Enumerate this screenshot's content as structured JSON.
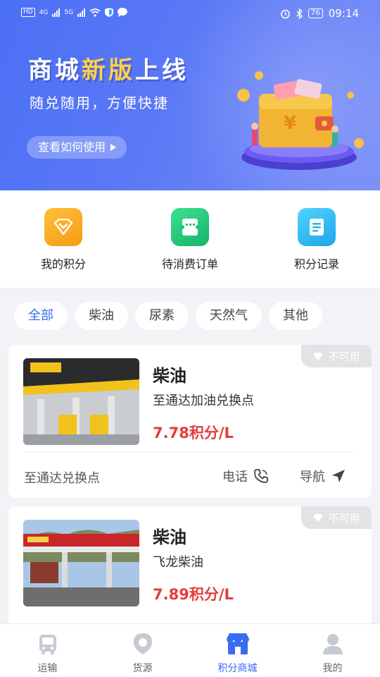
{
  "status_bar": {
    "left_chips": [
      "HD",
      "4G",
      "5G"
    ],
    "battery": "76",
    "time": "09:14"
  },
  "banner": {
    "title_part1": "商城",
    "title_part2": "新版",
    "title_part3": "上线",
    "subtitle": "随兑随用，方便快捷",
    "button_label": "查看如何使用",
    "wallet_symbol": "¥"
  },
  "quick_actions": [
    {
      "label": "我的积分",
      "icon": "diamond-icon",
      "color": "#f7a21b"
    },
    {
      "label": "待消费订单",
      "icon": "ticket-icon",
      "color": "#1fc478"
    },
    {
      "label": "积分记录",
      "icon": "document-icon",
      "color": "#28b9f0"
    }
  ],
  "filters": {
    "items": [
      "全部",
      "柴油",
      "尿素",
      "天然气",
      "其他"
    ],
    "active": "全部"
  },
  "listings": [
    {
      "tag": "不可用",
      "title": "柴油",
      "name": "至通达加油兑换点",
      "price": "7.78积分/L",
      "footer_name": "至通达兑换点",
      "phone_label": "电话",
      "nav_label": "导航"
    },
    {
      "tag": "不可用",
      "title": "柴油",
      "name": "飞龙柴油",
      "price": "7.89积分/L"
    }
  ],
  "tabbar": {
    "items": [
      {
        "label": "运输",
        "icon": "truck-icon"
      },
      {
        "label": "货源",
        "icon": "location-pin-icon"
      },
      {
        "label": "积分商城",
        "icon": "store-icon"
      },
      {
        "label": "我的",
        "icon": "user-icon"
      }
    ],
    "active": "积分商城",
    "active_color": "#3a6cf0"
  }
}
